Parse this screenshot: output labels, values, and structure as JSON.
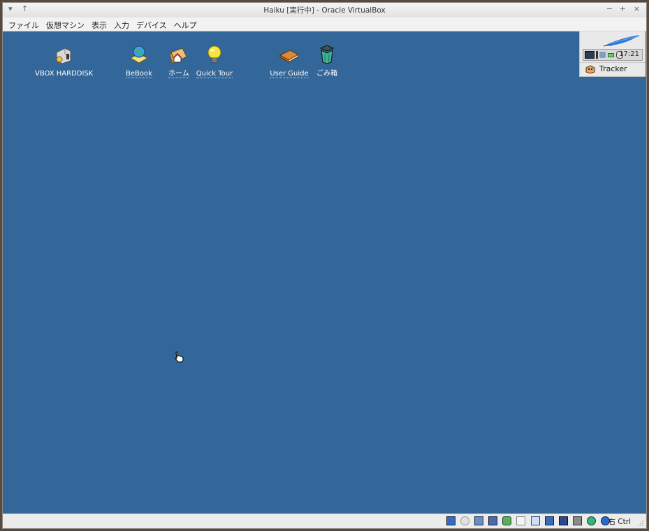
{
  "window": {
    "title": "Haiku [実行中] - Oracle VirtualBox",
    "controls": {
      "menu": "▾",
      "pin": "↑",
      "minimize": "−",
      "maximize": "+",
      "close": "×"
    }
  },
  "menubar": {
    "items": [
      "ファイル",
      "仮想マシン",
      "表示",
      "入力",
      "デバイス",
      "ヘルプ"
    ]
  },
  "desktop": {
    "background": "#336699",
    "icons": [
      {
        "label": "VBOX HARDDISK",
        "icon": "harddisk-icon"
      },
      {
        "label": "BeBook",
        "icon": "globe-book-icon"
      },
      {
        "label": "ホーム",
        "icon": "home-folder-icon"
      },
      {
        "label": "Quick Tour",
        "icon": "lightbulb-icon"
      },
      {
        "label": "User Guide",
        "icon": "book-icon"
      },
      {
        "label": "ごみ箱",
        "icon": "trash-icon"
      }
    ]
  },
  "deskbar": {
    "logo": "haiku-leaf-icon",
    "clock": "17:21",
    "tracker_label": "Tracker"
  },
  "statusbar": {
    "host_key": "右 Ctrl",
    "icons": [
      "hard-disk-icon",
      "optical-drive-icon",
      "audio-icon",
      "network-icon",
      "usb-icon",
      "shared-folder-icon",
      "display-icon",
      "video-capture-icon",
      "recording-icon",
      "mouse-integration-icon",
      "cpu-icon",
      "keyboard-icon"
    ]
  }
}
